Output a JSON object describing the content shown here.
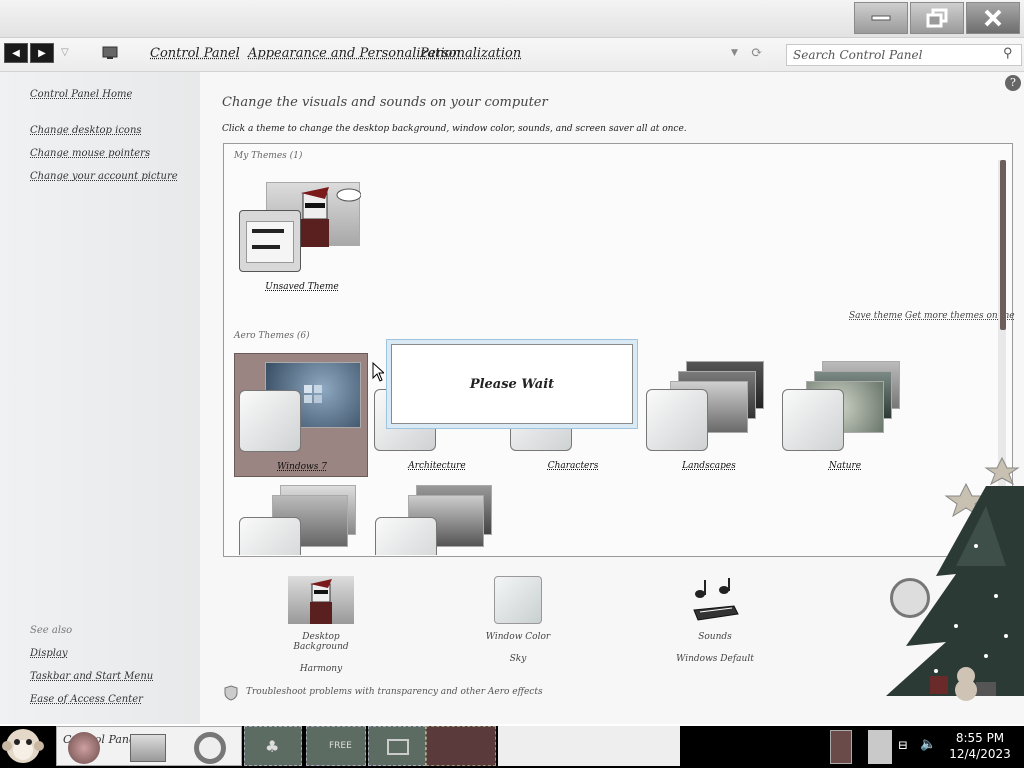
{
  "window": {
    "buttons": {
      "minimize": "minimize-icon",
      "maximize": "restore-icon",
      "close": "close-icon"
    }
  },
  "address_bar": {
    "breadcrumbs": [
      "Control Panel",
      "Appearance and Personalization",
      "Personalization"
    ],
    "search_placeholder": "Search Control Panel"
  },
  "left_nav": {
    "home": "Control Panel Home",
    "links": [
      "Change desktop icons",
      "Change mouse pointers",
      "Change your account picture"
    ],
    "see_also_title": "See also",
    "see_also": [
      "Display",
      "Taskbar and Start Menu",
      "Ease of Access Center"
    ]
  },
  "main": {
    "heading": "Change the visuals and sounds on your computer",
    "subheading": "Click a theme to change the desktop background, window color, sounds, and screen saver all at once.",
    "my_themes_label": "My Themes (1)",
    "unsaved_theme": "Unsaved Theme",
    "save_theme": "Save theme",
    "get_more_themes": "Get more themes online",
    "aero_themes_label": "Aero Themes (6)",
    "aero_themes": [
      "Windows 7",
      "Architecture",
      "Characters",
      "Landscapes",
      "Nature"
    ],
    "please_wait": "Please Wait"
  },
  "bottom": {
    "desktop_background": {
      "title": "Desktop Background",
      "value": "Harmony"
    },
    "window_color": {
      "title": "Window Color",
      "value": "Sky"
    },
    "sounds": {
      "title": "Sounds",
      "value": "Windows Default"
    },
    "troubleshoot": "Troubleshoot problems with transparency and other Aero effects"
  },
  "taskbar": {
    "active_window": "Control Panel",
    "time": "8:55 PM",
    "date": "12/4/2023"
  }
}
